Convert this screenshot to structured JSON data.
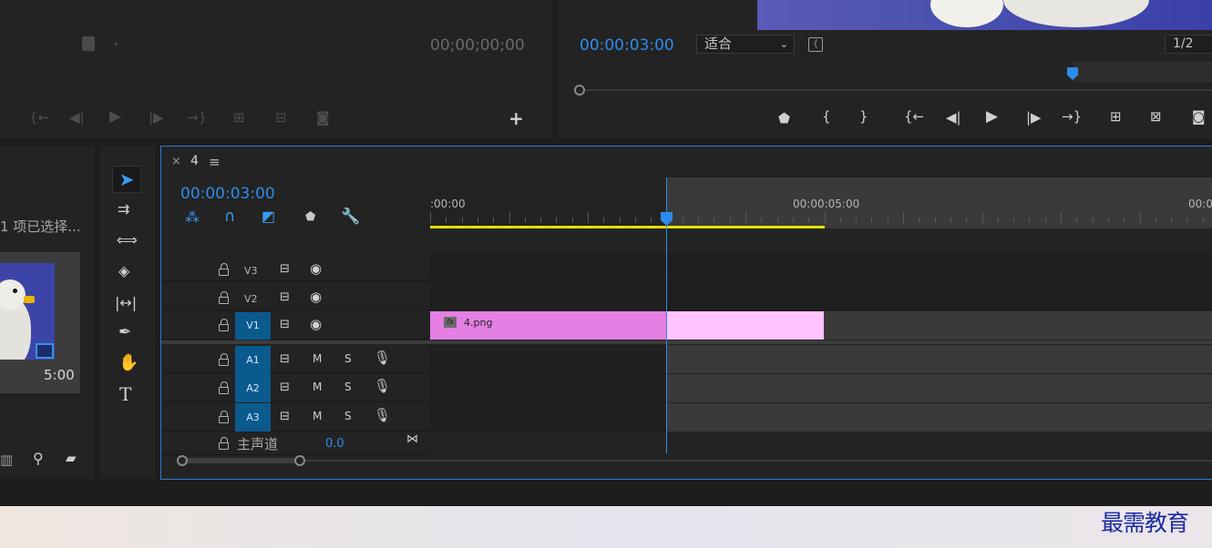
{
  "source_monitor": {
    "timecode": "00;00;00;00",
    "add_button": "+"
  },
  "program_monitor": {
    "timecode": "00:00:03:00",
    "fit_select": "适合",
    "resolution": "1/2"
  },
  "project_panel": {
    "selection_text": "1 项已选择...",
    "duration": "5:00"
  },
  "timeline": {
    "close_label": "×",
    "sequence_name": "4",
    "menu_icon": "≡",
    "timecode": "00:00:03:00",
    "ruler_labels": [
      ":00:00",
      "00:00:05:00",
      "00:0"
    ],
    "tracks": {
      "v3": "V3",
      "v2": "V2",
      "v1": "V1",
      "a1": "A1",
      "a2": "A2",
      "a3": "A3"
    },
    "mute_label": "M",
    "solo_label": "S",
    "master_label": "主声道",
    "master_value": "0.0",
    "clip_name": "4.png",
    "fx_label": "fx"
  },
  "watermark": "最需教育",
  "colors": {
    "accent_blue": "#2d8ceb",
    "clip_pink": "#e47fe3",
    "clip_light": "#ffc3ff",
    "work_area_yellow": "#e8e000"
  }
}
